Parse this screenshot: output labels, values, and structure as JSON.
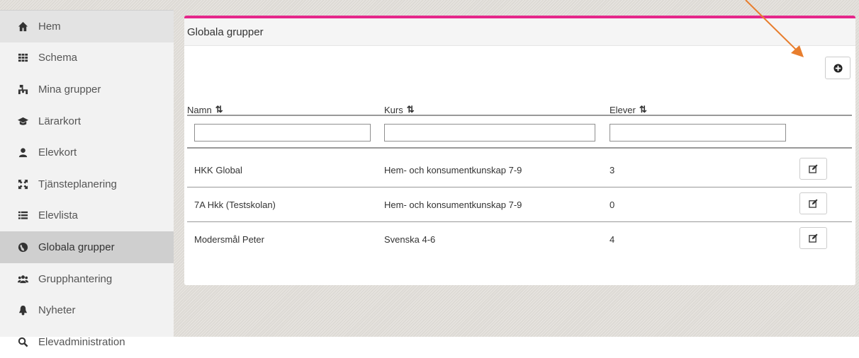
{
  "sidebar": {
    "items": [
      {
        "label": "Hem",
        "icon": "home-icon"
      },
      {
        "label": "Schema",
        "icon": "grid-icon"
      },
      {
        "label": "Mina grupper",
        "icon": "sitemap-icon"
      },
      {
        "label": "Lärarkort",
        "icon": "graduation-cap-icon"
      },
      {
        "label": "Elevkort",
        "icon": "user-icon"
      },
      {
        "label": "Tjänsteplanering",
        "icon": "expand-icon"
      },
      {
        "label": "Elevlista",
        "icon": "list-icon"
      },
      {
        "label": "Globala grupper",
        "icon": "globe-icon"
      },
      {
        "label": "Grupphantering",
        "icon": "users-icon"
      },
      {
        "label": "Nyheter",
        "icon": "bell-icon"
      },
      {
        "label": "Elevadministration",
        "icon": "search-icon"
      }
    ],
    "active_index": 7
  },
  "panel": {
    "title": "Globala grupper",
    "accent_color": "#e5278a"
  },
  "table": {
    "columns": [
      "Namn",
      "Kurs",
      "Elever"
    ],
    "filters": {
      "namn": "",
      "kurs": "",
      "elever": ""
    },
    "rows": [
      {
        "namn": "HKK Global",
        "kurs": "Hem- och konsumentkunskap 7-9",
        "elever": "3"
      },
      {
        "namn": "7A Hkk (Testskolan)",
        "kurs": "Hem- och konsumentkunskap 7-9",
        "elever": "0"
      },
      {
        "namn": "Modersmål Peter",
        "kurs": "Svenska 4-6",
        "elever": "4"
      }
    ]
  },
  "annotation": {
    "color": "#e87e2e"
  }
}
